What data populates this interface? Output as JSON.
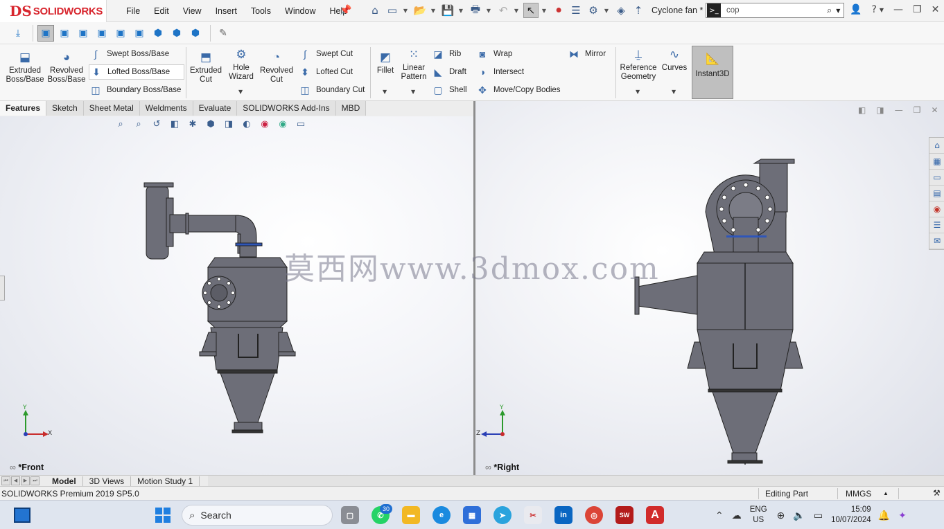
{
  "app": {
    "logo_prefix": "DS",
    "logo_text": "SOLIDWORKS",
    "document_title": "Cyclone fan *",
    "search_value": "cop"
  },
  "menu": [
    "File",
    "Edit",
    "View",
    "Insert",
    "Tools",
    "Window",
    "Help"
  ],
  "ribbon": {
    "extruded_boss": "Extruded\nBoss/Base",
    "revolved_boss": "Revolved\nBoss/Base",
    "swept_boss": "Swept Boss/Base",
    "lofted_boss": "Lofted Boss/Base",
    "boundary_boss": "Boundary Boss/Base",
    "extruded_cut": "Extruded\nCut",
    "hole_wizard": "Hole\nWizard",
    "revolved_cut": "Revolved\nCut",
    "swept_cut": "Swept Cut",
    "lofted_cut": "Lofted Cut",
    "boundary_cut": "Boundary Cut",
    "fillet": "Fillet",
    "linear_pattern": "Linear\nPattern",
    "rib": "Rib",
    "draft": "Draft",
    "shell": "Shell",
    "wrap": "Wrap",
    "intersect": "Intersect",
    "move_copy": "Move/Copy Bodies",
    "mirror": "Mirror",
    "reference_geometry": "Reference\nGeometry",
    "curves": "Curves",
    "instant3d": "Instant3D"
  },
  "command_tabs": [
    "Features",
    "Sketch",
    "Sheet Metal",
    "Weldments",
    "Evaluate",
    "SOLIDWORKS Add-Ins",
    "MBD"
  ],
  "viewports": {
    "left_label": "*Front",
    "right_label": "*Right",
    "left_axes": {
      "y": "Y",
      "x": "X"
    },
    "right_axes": {
      "y": "Y",
      "z": "Z"
    }
  },
  "watermark": "莫西网www.3dmox.com",
  "bottom_tabs": [
    "Model",
    "3D Views",
    "Motion Study 1"
  ],
  "status": {
    "product": "SOLIDWORKS Premium 2019 SP5.0",
    "mode": "Editing Part",
    "units": "MMGS"
  },
  "taskbar": {
    "search_label": "Search",
    "whatsapp_badge": "30",
    "lang_line1": "ENG",
    "lang_line2": "US",
    "time": "15:09",
    "date": "10/07/2024"
  },
  "colors": {
    "brand_red": "#d8262e",
    "model_gray": "#6d6e78",
    "accent_blue": "#1e74c6"
  }
}
